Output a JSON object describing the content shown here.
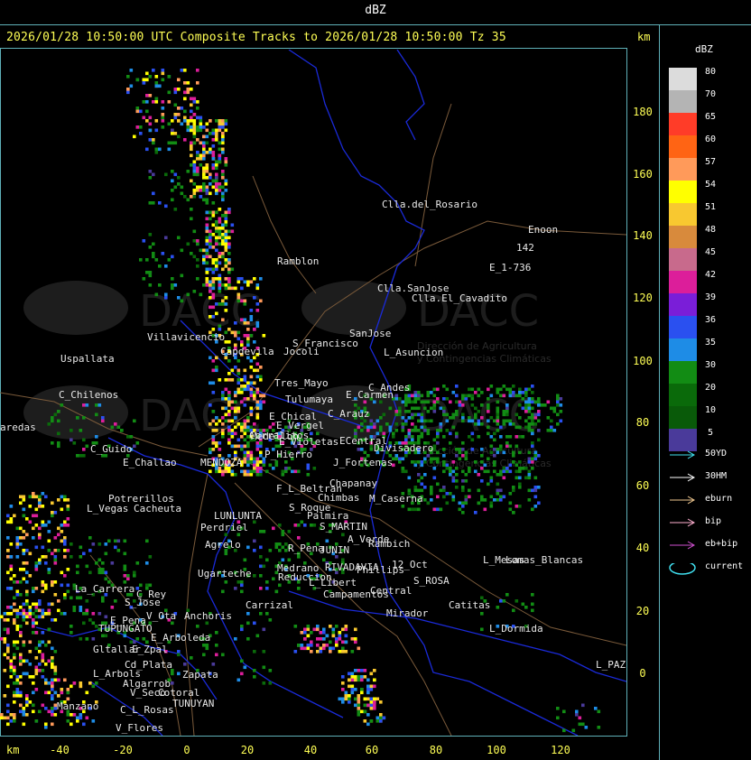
{
  "header": {
    "title": "dBZ",
    "subtitle": "2026/01/28 10:50:00 UTC Composite Tracks to 2026/01/28 10:50:00 Tz 35"
  },
  "axes": {
    "unit_top": "km",
    "unit_bottom": "km",
    "y_ticks": [
      "180",
      "160",
      "140",
      "120",
      "100",
      "80",
      "60",
      "40",
      "20",
      "0"
    ],
    "x_ticks": [
      "-40",
      "-20",
      "0",
      "20",
      "40",
      "60",
      "80",
      "100",
      "120"
    ]
  },
  "legend": {
    "title": "dBZ",
    "levels": [
      {
        "value": "80",
        "color": "#dcdcdc"
      },
      {
        "value": "70",
        "color": "#b4b4b4"
      },
      {
        "value": "65",
        "color": "#ff3c28"
      },
      {
        "value": "60",
        "color": "#ff6414"
      },
      {
        "value": "57",
        "color": "#ff9a5a"
      },
      {
        "value": "54",
        "color": "#ffff00"
      },
      {
        "value": "51",
        "color": "#f8c830"
      },
      {
        "value": "48",
        "color": "#d88a3c"
      },
      {
        "value": "45",
        "color": "#c86a8c"
      },
      {
        "value": "42",
        "color": "#dc1e9a"
      },
      {
        "value": "39",
        "color": "#7a1ed8"
      },
      {
        "value": "36",
        "color": "#2a50f0"
      },
      {
        "value": "35",
        "color": "#1e8ce6"
      },
      {
        "value": "30",
        "color": "#128c14"
      },
      {
        "value": "20",
        "color": "#0a6a0a"
      },
      {
        "value": "10",
        "color": "#095a09"
      },
      {
        "value": "5",
        "color": "#4a3a9a"
      }
    ],
    "tracks": [
      {
        "label": "50YD",
        "color": "#40e0f0"
      },
      {
        "label": "30HM",
        "color": "#ffffff"
      },
      {
        "label": "eburn",
        "color": "#f0c890"
      },
      {
        "label": "bip",
        "color": "#ffb0d0"
      },
      {
        "label": "eb+bip",
        "color": "#d050d0"
      },
      {
        "label": "current",
        "color": "#40e0f0"
      }
    ]
  },
  "watermark": {
    "brand": "DACC",
    "line1": "Dirección de Agricultura",
    "line2": "y Contingencias Climáticas"
  },
  "places": [
    {
      "name": "Clla.del_Rosario",
      "x": 423,
      "y": 220
    },
    {
      "name": "Enoon",
      "x": 585,
      "y": 248
    },
    {
      "name": "142",
      "x": 572,
      "y": 268
    },
    {
      "name": "E_1-736",
      "x": 542,
      "y": 290
    },
    {
      "name": "Ramblon",
      "x": 307,
      "y": 283
    },
    {
      "name": "Clla.SanJose",
      "x": 418,
      "y": 313
    },
    {
      "name": "Clla.El_Cavadito",
      "x": 456,
      "y": 324
    },
    {
      "name": "Villavicencio",
      "x": 163,
      "y": 367
    },
    {
      "name": "Capdevila",
      "x": 244,
      "y": 383
    },
    {
      "name": "S_Francisco",
      "x": 324,
      "y": 374
    },
    {
      "name": "SanJose",
      "x": 387,
      "y": 363
    },
    {
      "name": "L_Asuncion",
      "x": 425,
      "y": 384
    },
    {
      "name": "Uspallata",
      "x": 67,
      "y": 391
    },
    {
      "name": "Jocoli",
      "x": 314,
      "y": 383
    },
    {
      "name": "Tres_Mayo",
      "x": 304,
      "y": 418
    },
    {
      "name": "C_Andes",
      "x": 408,
      "y": 423
    },
    {
      "name": "E_Carmen",
      "x": 383,
      "y": 431
    },
    {
      "name": "C_Chilenos",
      "x": 65,
      "y": 431
    },
    {
      "name": "Tulumaya",
      "x": 316,
      "y": 436
    },
    {
      "name": "C_Arauz",
      "x": 363,
      "y": 452
    },
    {
      "name": "E_Chical",
      "x": 298,
      "y": 455
    },
    {
      "name": "E_Vergel",
      "x": 306,
      "y": 465
    },
    {
      "name": "aredas",
      "x": 0,
      "y": 467
    },
    {
      "name": "Corralitos",
      "x": 276,
      "y": 476
    },
    {
      "name": "Medellon",
      "x": 278,
      "y": 477
    },
    {
      "name": "E_Violetas",
      "x": 309,
      "y": 483
    },
    {
      "name": "ECentral",
      "x": 376,
      "y": 482
    },
    {
      "name": "Divisadero",
      "x": 414,
      "y": 490
    },
    {
      "name": "C_Guido",
      "x": 100,
      "y": 491
    },
    {
      "name": "P_Hierro",
      "x": 293,
      "y": 497
    },
    {
      "name": "E_Challao",
      "x": 136,
      "y": 506
    },
    {
      "name": "MENDOZA",
      "x": 222,
      "y": 506
    },
    {
      "name": "J_Fortenas",
      "x": 369,
      "y": 506
    },
    {
      "name": "Chapanay",
      "x": 365,
      "y": 529
    },
    {
      "name": "F_L_Beltran",
      "x": 306,
      "y": 535
    },
    {
      "name": "Potrerillos",
      "x": 120,
      "y": 546
    },
    {
      "name": "Chimbas",
      "x": 352,
      "y": 545
    },
    {
      "name": "M_Caserna",
      "x": 409,
      "y": 546
    },
    {
      "name": "L_Vegas",
      "x": 96,
      "y": 557
    },
    {
      "name": "Cacheuta",
      "x": 148,
      "y": 557
    },
    {
      "name": "S_Roque",
      "x": 320,
      "y": 556
    },
    {
      "name": "Palmira",
      "x": 340,
      "y": 565
    },
    {
      "name": "LUNLUNTA",
      "x": 237,
      "y": 565
    },
    {
      "name": "Perdriel",
      "x": 222,
      "y": 578
    },
    {
      "name": "S_MARTIN",
      "x": 354,
      "y": 577
    },
    {
      "name": "A_Verde",
      "x": 385,
      "y": 591
    },
    {
      "name": "Rambich",
      "x": 408,
      "y": 596
    },
    {
      "name": "Agrelo",
      "x": 227,
      "y": 597
    },
    {
      "name": "R_Pena",
      "x": 319,
      "y": 601
    },
    {
      "name": "JUNIN",
      "x": 354,
      "y": 603
    },
    {
      "name": "L_Mesas",
      "x": 535,
      "y": 614
    },
    {
      "name": "Lomas_Blancas",
      "x": 560,
      "y": 614
    },
    {
      "name": "Medrano",
      "x": 307,
      "y": 623
    },
    {
      "name": "RIVADAVIA",
      "x": 360,
      "y": 622
    },
    {
      "name": "12_Oct",
      "x": 434,
      "y": 619
    },
    {
      "name": "Phillips",
      "x": 395,
      "y": 625
    },
    {
      "name": "Ugarteche",
      "x": 219,
      "y": 629
    },
    {
      "name": "Reduccion",
      "x": 308,
      "y": 633
    },
    {
      "name": "L_Libert",
      "x": 342,
      "y": 639
    },
    {
      "name": "S_ROSA",
      "x": 458,
      "y": 637
    },
    {
      "name": "La_Carrera",
      "x": 83,
      "y": 646
    },
    {
      "name": "Campamentos",
      "x": 358,
      "y": 652
    },
    {
      "name": "Central",
      "x": 410,
      "y": 648
    },
    {
      "name": "C_Rey",
      "x": 151,
      "y": 652
    },
    {
      "name": "S_Jose",
      "x": 138,
      "y": 661
    },
    {
      "name": "Carrizal",
      "x": 272,
      "y": 664
    },
    {
      "name": "Catitas",
      "x": 497,
      "y": 664
    },
    {
      "name": "V_Ota",
      "x": 162,
      "y": 676
    },
    {
      "name": "Anchoris",
      "x": 204,
      "y": 676
    },
    {
      "name": "Mirador",
      "x": 428,
      "y": 673
    },
    {
      "name": "E_Pena",
      "x": 122,
      "y": 681
    },
    {
      "name": "TUPUNGATO",
      "x": 109,
      "y": 690
    },
    {
      "name": "L_Dormida",
      "x": 542,
      "y": 690
    },
    {
      "name": "E_Arboleda",
      "x": 167,
      "y": 700
    },
    {
      "name": "Gltallar",
      "x": 103,
      "y": 713
    },
    {
      "name": "E_Zpal",
      "x": 146,
      "y": 713
    },
    {
      "name": "Cd_Plata",
      "x": 138,
      "y": 730
    },
    {
      "name": "L_PAZ",
      "x": 660,
      "y": 730
    },
    {
      "name": "L_Arbols",
      "x": 103,
      "y": 740
    },
    {
      "name": "Zapata",
      "x": 202,
      "y": 741
    },
    {
      "name": "Algarrob",
      "x": 136,
      "y": 751
    },
    {
      "name": "V_Seco",
      "x": 144,
      "y": 761
    },
    {
      "name": "Cotoral",
      "x": 175,
      "y": 761
    },
    {
      "name": "TUNUYAN",
      "x": 191,
      "y": 773
    },
    {
      "name": "Manzano",
      "x": 63,
      "y": 776
    },
    {
      "name": "C_L_Rosas",
      "x": 133,
      "y": 780
    },
    {
      "name": "V_Flores",
      "x": 128,
      "y": 800
    }
  ]
}
